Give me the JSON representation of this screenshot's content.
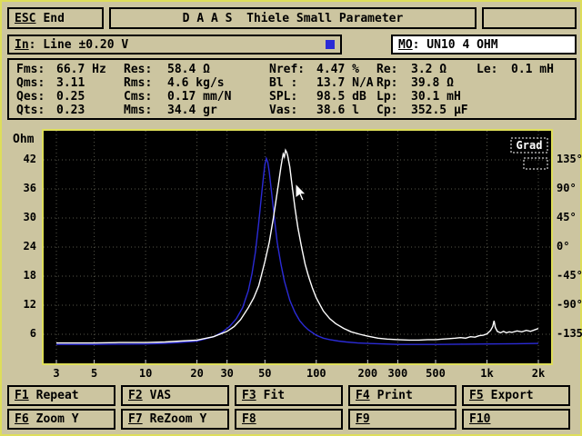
{
  "colors": {
    "background": "#ccc5a0",
    "frame_yellow": "#dede5a",
    "plot_background": "#000000",
    "impedance_curve": "#ffffff",
    "reference_curve": "#2b2bd6",
    "model_box_background": "#ffffff"
  },
  "titlebar": {
    "esc_key": "ESC",
    "esc_label": "End",
    "title": "D A A S  Thiele Small Parameter"
  },
  "status": {
    "in_key": "In",
    "in_rest": ": Line ±0.20 V",
    "mo_key": "MO",
    "mo_rest": ": UN10 4 OHM"
  },
  "parameters": {
    "rows": [
      [
        {
          "label": "Fms:",
          "value": "66.7 Hz"
        },
        {
          "label": "Res:",
          "value": "58.4 Ω"
        },
        {
          "label": "Nref:",
          "value": "4.47 %"
        },
        {
          "label": "Re:",
          "value": "3.2 Ω"
        },
        {
          "label": "Le:",
          "value": "0.1 mH"
        }
      ],
      [
        {
          "label": "Qms:",
          "value": "3.11"
        },
        {
          "label": "Rms:",
          "value": "4.6 kg/s"
        },
        {
          "label": "Bl :",
          "value": "13.7 N/A"
        },
        {
          "label": "Rp:",
          "value": "39.8 Ω"
        }
      ],
      [
        {
          "label": "Qes:",
          "value": "0.25"
        },
        {
          "label": "Cms:",
          "value": "0.17 mm/N"
        },
        {
          "label": "SPL:",
          "value": "98.5 dB"
        },
        {
          "label": "Lp:",
          "value": "30.1 mH"
        }
      ],
      [
        {
          "label": "Qts:",
          "value": "0.23"
        },
        {
          "label": "Mms:",
          "value": "34.4 gr"
        },
        {
          "label": "Vas:",
          "value": "38.6 l"
        },
        {
          "label": "Cp:",
          "value": "352.5 µF"
        }
      ]
    ]
  },
  "chart_data": {
    "type": "line",
    "left_unit": "Ohm",
    "right_unit": "Grad",
    "x_scale": "log",
    "x_range": [
      3,
      2000
    ],
    "y_left_range": [
      0,
      48
    ],
    "y_right_range": [
      -157.5,
      202.5
    ],
    "x_ticks": [
      {
        "f": 3,
        "label": "3"
      },
      {
        "f": 5,
        "label": "5"
      },
      {
        "f": 10,
        "label": "10"
      },
      {
        "f": 20,
        "label": "20"
      },
      {
        "f": 30,
        "label": "30"
      },
      {
        "f": 50,
        "label": "50"
      },
      {
        "f": 100,
        "label": "100"
      },
      {
        "f": 200,
        "label": "200"
      },
      {
        "f": 300,
        "label": "300"
      },
      {
        "f": 500,
        "label": "500"
      },
      {
        "f": 1000,
        "label": "1k"
      },
      {
        "f": 2000,
        "label": "2k"
      }
    ],
    "y_ticks": [
      {
        "ohm": 42,
        "grad": "135°"
      },
      {
        "ohm": 36,
        "grad": "90°"
      },
      {
        "ohm": 30,
        "grad": "45°"
      },
      {
        "ohm": 24,
        "grad": "0°"
      },
      {
        "ohm": 18,
        "grad": "-45°"
      },
      {
        "ohm": 12,
        "grad": "-90°"
      },
      {
        "ohm": 6,
        "grad": "-135°"
      }
    ],
    "series": [
      {
        "name": "reference-added-mass",
        "color": "#2b2bd6",
        "points": [
          [
            3,
            3.9
          ],
          [
            5,
            3.9
          ],
          [
            7,
            3.95
          ],
          [
            10,
            4.0
          ],
          [
            13,
            4.1
          ],
          [
            16,
            4.3
          ],
          [
            20,
            4.6
          ],
          [
            25,
            5.5
          ],
          [
            28,
            6.4
          ],
          [
            31,
            7.6
          ],
          [
            34,
            9.2
          ],
          [
            37,
            11.5
          ],
          [
            40,
            15
          ],
          [
            42,
            18.5
          ],
          [
            44,
            23
          ],
          [
            46,
            29
          ],
          [
            48,
            35.5
          ],
          [
            49,
            38.5
          ],
          [
            50,
            41
          ],
          [
            51,
            42.3
          ],
          [
            52,
            41.5
          ],
          [
            53,
            39.5
          ],
          [
            55,
            34.5
          ],
          [
            57,
            29.5
          ],
          [
            59,
            25
          ],
          [
            62,
            20.5
          ],
          [
            65,
            17
          ],
          [
            70,
            13
          ],
          [
            75,
            10.5
          ],
          [
            80,
            8.8
          ],
          [
            85,
            7.7
          ],
          [
            90,
            6.9
          ],
          [
            100,
            5.8
          ],
          [
            110,
            5.2
          ],
          [
            120,
            4.9
          ],
          [
            135,
            4.6
          ],
          [
            150,
            4.4
          ],
          [
            175,
            4.2
          ],
          [
            200,
            4.1
          ],
          [
            250,
            4.0
          ],
          [
            300,
            3.9
          ],
          [
            400,
            3.9
          ],
          [
            500,
            3.9
          ],
          [
            700,
            3.95
          ],
          [
            1000,
            4.0
          ],
          [
            1500,
            4.05
          ],
          [
            2000,
            4.1
          ]
        ]
      },
      {
        "name": "impedance",
        "color": "#ffffff",
        "points": [
          [
            3,
            4.2
          ],
          [
            4,
            4.2
          ],
          [
            5,
            4.2
          ],
          [
            7,
            4.3
          ],
          [
            10,
            4.3
          ],
          [
            13,
            4.4
          ],
          [
            16,
            4.6
          ],
          [
            20,
            4.8
          ],
          [
            25,
            5.5
          ],
          [
            30,
            6.6
          ],
          [
            33,
            7.6
          ],
          [
            36,
            9
          ],
          [
            40,
            11.5
          ],
          [
            43,
            13.5
          ],
          [
            46,
            16
          ],
          [
            50,
            21
          ],
          [
            53,
            25
          ],
          [
            56,
            30
          ],
          [
            58,
            33.5
          ],
          [
            60,
            37
          ],
          [
            62,
            40.5
          ],
          [
            63,
            42
          ],
          [
            64,
            43.2
          ],
          [
            65,
            42.6
          ],
          [
            66,
            44
          ],
          [
            67,
            43.6
          ],
          [
            68,
            42.8
          ],
          [
            70,
            40.5
          ],
          [
            72,
            37
          ],
          [
            75,
            32
          ],
          [
            78,
            28
          ],
          [
            82,
            24
          ],
          [
            86,
            20.5
          ],
          [
            90,
            18
          ],
          [
            95,
            15.5
          ],
          [
            100,
            13.5
          ],
          [
            110,
            10.8
          ],
          [
            120,
            9.2
          ],
          [
            130,
            8.2
          ],
          [
            145,
            7.2
          ],
          [
            160,
            6.5
          ],
          [
            180,
            6
          ],
          [
            200,
            5.6
          ],
          [
            230,
            5.2
          ],
          [
            260,
            5
          ],
          [
            300,
            4.9
          ],
          [
            350,
            4.8
          ],
          [
            400,
            4.8
          ],
          [
            450,
            4.9
          ],
          [
            500,
            4.9
          ],
          [
            550,
            5
          ],
          [
            600,
            5.1
          ],
          [
            650,
            5.2
          ],
          [
            700,
            5.3
          ],
          [
            750,
            5.2
          ],
          [
            800,
            5.5
          ],
          [
            850,
            5.4
          ],
          [
            900,
            5.7
          ],
          [
            950,
            5.8
          ],
          [
            1000,
            6.1
          ],
          [
            1050,
            6.8
          ],
          [
            1080,
            7.6
          ],
          [
            1100,
            8.8
          ],
          [
            1120,
            7.4
          ],
          [
            1150,
            6.6
          ],
          [
            1200,
            6.3
          ],
          [
            1250,
            6.6
          ],
          [
            1300,
            6.3
          ],
          [
            1350,
            6.5
          ],
          [
            1400,
            6.4
          ],
          [
            1500,
            6.7
          ],
          [
            1600,
            6.5
          ],
          [
            1700,
            6.8
          ],
          [
            1800,
            6.6
          ],
          [
            1900,
            6.9
          ],
          [
            2000,
            7.2
          ]
        ]
      }
    ]
  },
  "fkeys": {
    "rows": [
      [
        {
          "key": "F1",
          "label": "Repeat"
        },
        {
          "key": "F2",
          "label": "VAS"
        },
        {
          "key": "F3",
          "label": "Fit"
        },
        {
          "key": "F4",
          "label": "Print"
        },
        {
          "key": "F5",
          "label": "Export"
        }
      ],
      [
        {
          "key": "F6",
          "label": "Zoom Y"
        },
        {
          "key": "F7",
          "label": "ReZoom Y"
        },
        {
          "key": "F8",
          "label": ""
        },
        {
          "key": "F9",
          "label": ""
        },
        {
          "key": "F10",
          "label": ""
        }
      ]
    ]
  }
}
